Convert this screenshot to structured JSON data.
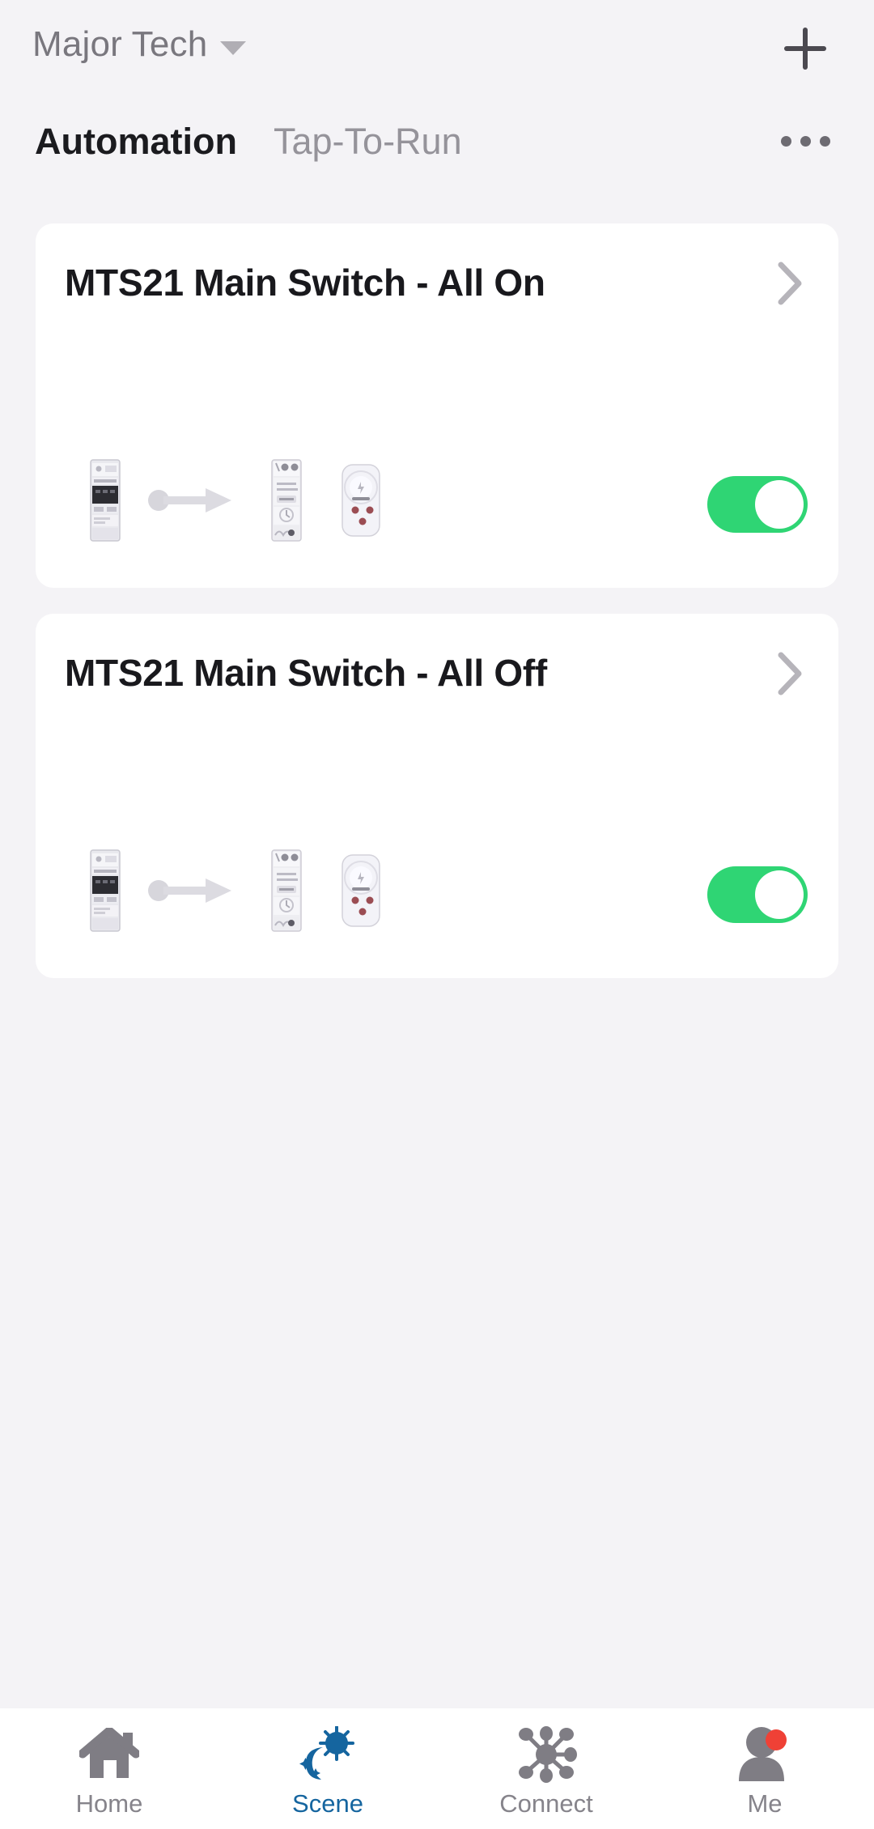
{
  "header": {
    "home_name": "Major Tech",
    "caret_icon": "chevron-down-icon",
    "add_icon": "plus-icon",
    "overflow_icon": "more-horizontal-icon"
  },
  "tabs": [
    {
      "label": "Automation",
      "active": true
    },
    {
      "label": "Tap-To-Run",
      "active": false
    }
  ],
  "automations": [
    {
      "title": "MTS21 Main Switch - All On",
      "chevron_icon": "chevron-right-icon",
      "enabled": true,
      "toggle_state": "on",
      "devices": [
        {
          "icon": "din-rail-energy-meter-icon"
        },
        {
          "icon": "arrow-right-connector-icon"
        },
        {
          "icon": "din-rail-smart-module-icon"
        },
        {
          "icon": "smart-plug-icon"
        }
      ]
    },
    {
      "title": "MTS21 Main Switch - All Off",
      "chevron_icon": "chevron-right-icon",
      "enabled": true,
      "toggle_state": "on",
      "devices": [
        {
          "icon": "din-rail-energy-meter-icon"
        },
        {
          "icon": "arrow-right-connector-icon"
        },
        {
          "icon": "din-rail-smart-module-icon"
        },
        {
          "icon": "smart-plug-icon"
        }
      ]
    }
  ],
  "bottom_nav": [
    {
      "label": "Home",
      "icon": "house-icon",
      "active": false,
      "badge": false
    },
    {
      "label": "Scene",
      "icon": "sun-moon-scene-icon",
      "active": true,
      "badge": false
    },
    {
      "label": "Connect",
      "icon": "network-hub-icon",
      "active": false,
      "badge": false
    },
    {
      "label": "Me",
      "icon": "person-icon",
      "active": false,
      "badge": true
    }
  ],
  "colors": {
    "background": "#f4f3f6",
    "card": "#ffffff",
    "toggle_on": "#2fd574",
    "accent_blue": "#15659f",
    "nav_gray": "#86848b",
    "badge_red": "#ef4136",
    "title_dark": "#19191d",
    "muted_text": "#95939a"
  }
}
